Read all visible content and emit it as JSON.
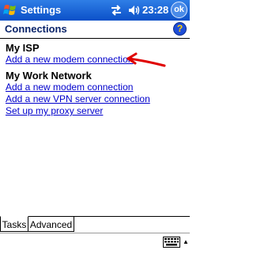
{
  "titlebar": {
    "title": "Settings",
    "time": "23:28",
    "ok_label": "ok",
    "start_icon": "windows-flag-icon",
    "connectivity_icon": "connectivity-arrows-icon",
    "volume_icon": "speaker-icon"
  },
  "header": {
    "title": "Connections",
    "help_label": "?"
  },
  "groups": [
    {
      "title": "My ISP",
      "links": [
        "Add a new modem connection"
      ]
    },
    {
      "title": "My Work Network",
      "links": [
        "Add a new modem connection",
        "Add a new VPN server connection",
        "Set up my proxy server"
      ]
    }
  ],
  "annotation": {
    "icon": "red-arrow-icon",
    "color": "#e00000"
  },
  "tabs": [
    {
      "label": "Tasks",
      "selected": true
    },
    {
      "label": "Advanced",
      "selected": false
    }
  ],
  "menubar": {
    "input_icon": "keyboard-icon"
  },
  "colors": {
    "titlebar": "#0b50c8",
    "link": "#0000cc",
    "header_text": "#0a246a"
  }
}
